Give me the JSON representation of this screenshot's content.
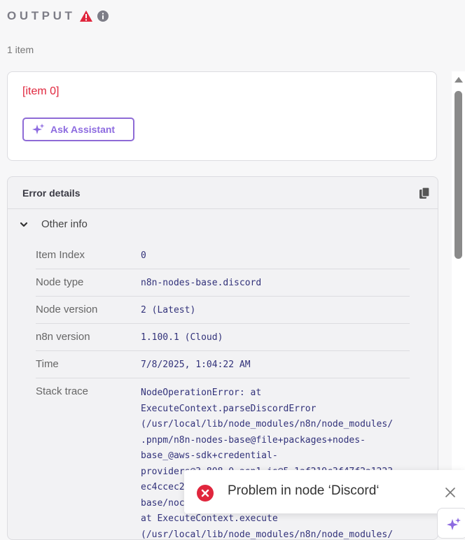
{
  "header": {
    "title": "OUTPUT",
    "warn_icon": "warning-triangle-icon",
    "info_icon": "info-circle-icon"
  },
  "item_count": "1 item",
  "item_card": {
    "label": "[item 0]",
    "ask_button": "Ask Assistant"
  },
  "error_details": {
    "title": "Error details",
    "copy_icon": "copy-icon",
    "section_label": "Other info",
    "rows": [
      {
        "label": "Item Index",
        "value": "0"
      },
      {
        "label": "Node type",
        "value": "n8n-nodes-base.discord"
      },
      {
        "label": "Node version",
        "value": "2 (Latest)"
      },
      {
        "label": "n8n version",
        "value": "1.100.1 (Cloud)"
      },
      {
        "label": "Time",
        "value": "7/8/2025, 1:04:22 AM"
      }
    ],
    "stack_label": "Stack trace",
    "stack_trace": "NodeOperationError: at\nExecuteContext.parseDiscordError\n(/usr/local/lib/node_modules/n8n/node_modules/\n.pnpm/n8n-nodes-base@file+packages+nodes-\nbase_@aws-sdk+credential-\nproviders@3.808.0_asn1.js@5.1af219c3f47f2a1223\nec4ccec2\nbase/noc\nat ExecuteContext.execute\n(/usr/local/lib/node_modules/n8n/node_modules/"
  },
  "toast": {
    "message": "Problem in node ‘Discord‘",
    "error_icon": "error-x-circle-icon",
    "close_icon": "close-icon"
  },
  "colors": {
    "error_red": "#e0263d",
    "accent_purple": "#8d6be0",
    "mono_text": "#32327a"
  }
}
